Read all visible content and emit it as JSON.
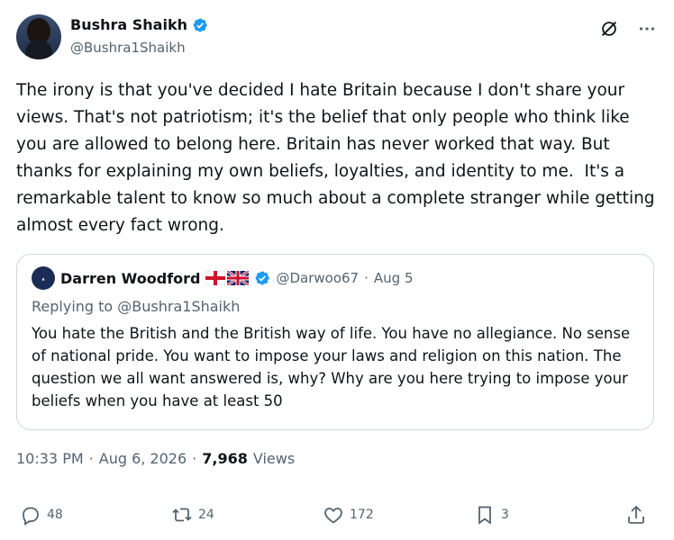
{
  "author": {
    "display_name": "Bushra Shaikh",
    "handle": "@Bushra1Shaikh"
  },
  "tweet": {
    "text": "The irony is that you've decided I hate Britain because I don't share your views. That's not patriotism; it's the belief that only people who think like you are allowed to belong here. Britain has never worked that way. But thanks for explaining my own beliefs, loyalties, and identity to me.  It's a remarkable talent to know so much about a complete stranger while getting almost every fact wrong."
  },
  "quoted": {
    "display_name": "Darren Woodford",
    "handle": "@Darwoo67",
    "separator": "·",
    "date": "Aug 5",
    "replying_to": "Replying to @Bushra1Shaikh",
    "text": "You hate the British and the British way of life.  You have no allegiance. No sense of national pride. You want to impose your laws and religion on this nation.  The question we all want answered is, why? Why are you here trying to impose your beliefs when you have at least 50"
  },
  "meta": {
    "time": "10:33 PM",
    "separator1": "·",
    "date": "Aug 6, 2026",
    "separator2": "·",
    "views_count": "7,968",
    "views_label": "Views"
  },
  "actions": {
    "replies": "48",
    "retweets": "24",
    "likes": "172",
    "bookmarks": "3"
  },
  "colors": {
    "verified": "#1d9bf0",
    "secondary_text": "#536471",
    "border": "#cfd9de"
  },
  "icons": [
    "verified-badge-icon",
    "grok-icon",
    "more-icon",
    "reply-icon",
    "retweet-icon",
    "like-icon",
    "bookmark-icon",
    "share-icon"
  ]
}
